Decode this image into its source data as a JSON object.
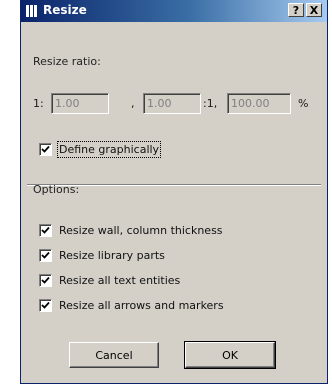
{
  "window": {
    "title": "Resize",
    "help_button": "?",
    "close_button": "X"
  },
  "ratio": {
    "section_label": "Resize ratio:",
    "prefix": "1:",
    "field1": "1.00",
    "sep1": ",",
    "field2": "1.00",
    "sep2": ":1,",
    "field3": "100.00",
    "suffix": "%"
  },
  "define_graphically": {
    "label": "Define graphically",
    "checked": true
  },
  "options": {
    "section_label": "Options:",
    "items": [
      {
        "label": "Resize wall, column thickness",
        "checked": true
      },
      {
        "label": "Resize library parts",
        "checked": true
      },
      {
        "label": "Resize all text entities",
        "checked": true
      },
      {
        "label": "Resize all arrows and markers",
        "checked": true
      }
    ]
  },
  "buttons": {
    "cancel": "Cancel",
    "ok": "OK"
  }
}
